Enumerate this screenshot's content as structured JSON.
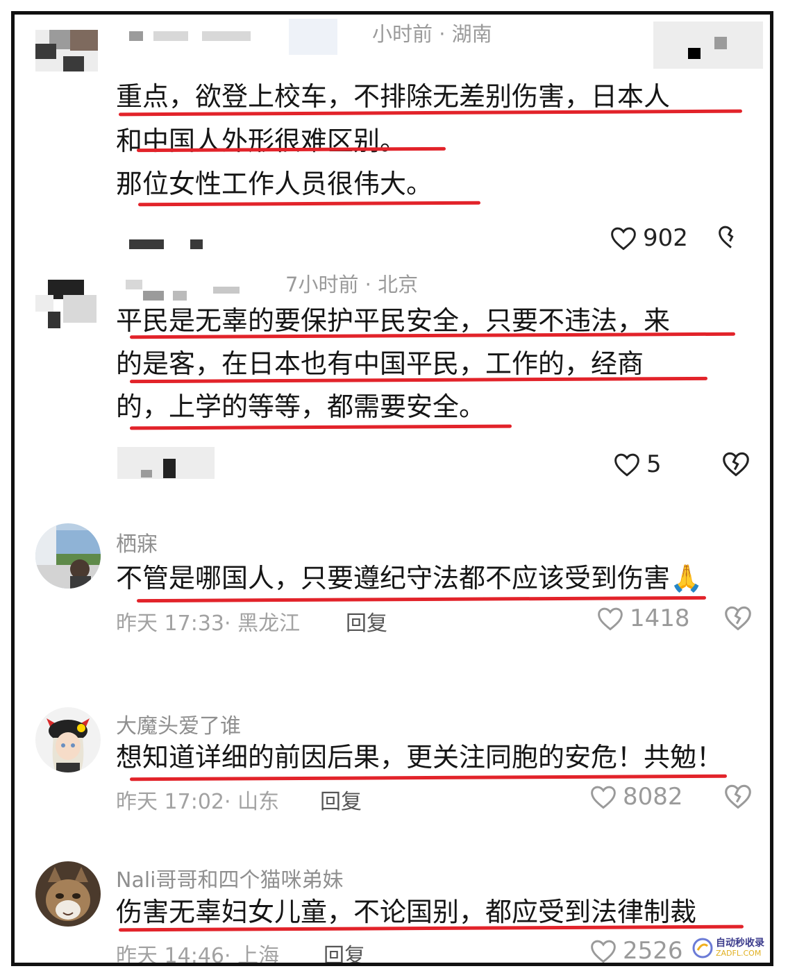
{
  "comments": [
    {
      "meta": "小时前 · 湖南",
      "lines": [
        "重点，欲登上校车，不排除无差别伤害，日本人",
        "和中国人外形很难区别。",
        "那位女性工作人员很伟大。"
      ],
      "likes": "902"
    },
    {
      "meta": "7小时前 · 北京",
      "lines": [
        "平民是无辜的要保护平民安全，只要不违法，来",
        "的是客，在日本也有中国平民，工作的，经商",
        "的，上学的等等，都需要安全。"
      ],
      "likes": "5"
    },
    {
      "name": "栖寐",
      "lines": [
        "不管是哪国人，只要遵纪守法都不应该受到伤害🙏"
      ],
      "time": "昨天 17:33· 黑龙江",
      "reply": "回复",
      "likes": "1418"
    },
    {
      "name": "大魔头爱了谁",
      "lines": [
        "想知道详细的前因后果，更关注同胞的安危！共勉！"
      ],
      "time": "昨天 17:02· 山东",
      "reply": "回复",
      "likes": "8082"
    },
    {
      "name": "Nali哥哥和四个猫咪弟妹",
      "lines": [
        "伤害无辜妇女儿童，不论国别，都应受到法律制裁"
      ],
      "time": "昨天 14:46· 上海",
      "reply": "回复",
      "likes": "2526"
    }
  ],
  "watermark": {
    "text": "自动秒收录",
    "sub": "ZADFL.COM"
  },
  "colors": {
    "underline": "#e2232a",
    "frame": "#111111"
  }
}
